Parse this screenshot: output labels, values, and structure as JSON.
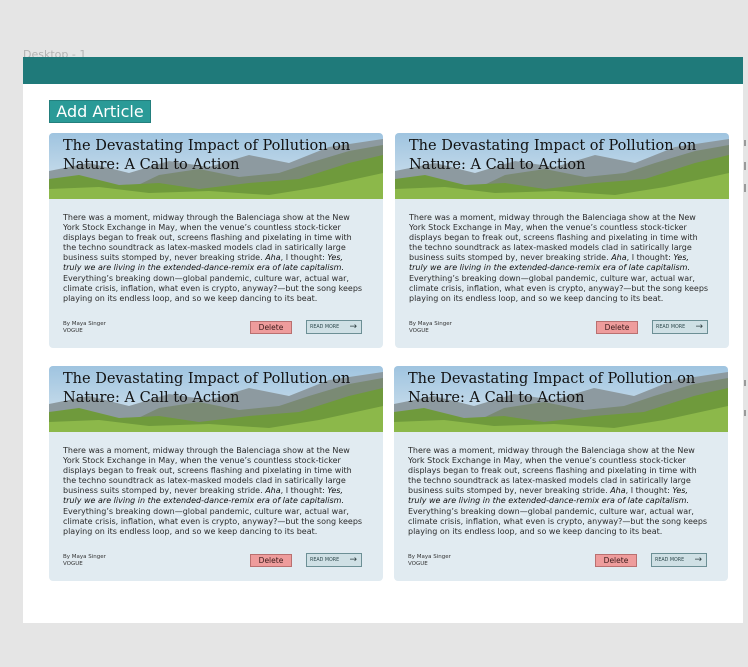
{
  "canvas": {
    "frame_label": "Desktop - 1"
  },
  "toolbar": {
    "add_article_label": "Add Article"
  },
  "colors": {
    "top_bar": "#1f7a7a",
    "add_button": "#2a9a97",
    "card_background": "#e1ebf1",
    "delete_button": "#ee9c9c",
    "read_more_button": "#cfe0e5"
  },
  "articles": [
    {
      "title": "The Devastating Impact of Pollution on Nature: A Call to Action",
      "body_start": "There was a moment, midway through the Balenciaga show at the New York Stock Exchange in May, when the venue’s countless stock-ticker displays began to freak out, screens flashing and pixelating in time with the techno soundtrack as latex-masked models clad in satirically large business suits stomped by, never breaking stride. ",
      "body_aha": "Aha",
      "body_thought": ", I thought: ",
      "body_quote": "Yes, truly we are living in the extended-dance-remix era of late capitalism.",
      "body_end": " Everything’s breaking down—global pandemic, culture war, actual war, climate crisis, inflation, what even is crypto, anyway?—but the song keeps playing on its endless loop, and so we keep dancing to its beat.",
      "author": "By Maya Singer",
      "publication": "VOGUE",
      "delete_label": "Delete",
      "read_more_label": "READ MORE",
      "read_more_icon": "arrow-right-icon"
    },
    {
      "title": "The Devastating Impact of Pollution on Nature: A Call to Action",
      "body_start": "There was a moment, midway through the Balenciaga show at the New York Stock Exchange in May, when the venue’s countless stock-ticker displays began to freak out, screens flashing and pixelating in time with the techno soundtrack as latex-masked models clad in satirically large business suits stomped by, never breaking stride. ",
      "body_aha": "Aha",
      "body_thought": ", I thought: ",
      "body_quote": "Yes, truly we are living in the extended-dance-remix era of late capitalism.",
      "body_end": " Everything’s breaking down—global pandemic, culture war, actual war, climate crisis, inflation, what even is crypto, anyway?—but the song keeps playing on its endless loop, and so we keep dancing to its beat.",
      "author": "By Maya Singer",
      "publication": "VOGUE",
      "delete_label": "Delete",
      "read_more_label": "READ MORE",
      "read_more_icon": "arrow-right-icon"
    },
    {
      "title": "The Devastating Impact of Pollution on Nature: A Call to Action",
      "body_start": "There was a moment, midway through the Balenciaga show at the New York Stock Exchange in May, when the venue’s countless stock-ticker displays began to freak out, screens flashing and pixelating in time with the techno soundtrack as latex-masked models clad in satirically large business suits stomped by, never breaking stride. ",
      "body_aha": "Aha",
      "body_thought": ", I thought: ",
      "body_quote": "Yes, truly we are living in the extended-dance-remix era of late capitalism.",
      "body_end": " Everything’s breaking down—global pandemic, culture war, actual war, climate crisis, inflation, what even is crypto, anyway?—but the song keeps playing on its endless loop, and so we keep dancing to its beat.",
      "author": "By Maya Singer",
      "publication": "VOGUE",
      "delete_label": "Delete",
      "read_more_label": "READ MORE",
      "read_more_icon": "arrow-right-icon"
    },
    {
      "title": "The Devastating Impact of Pollution on Nature: A Call to Action",
      "body_start": "There was a moment, midway through the Balenciaga show at the New York Stock Exchange in May, when the venue’s countless stock-ticker displays began to freak out, screens flashing and pixelating in time with the techno soundtrack as latex-masked models clad in satirically large business suits stomped by, never breaking stride. ",
      "body_aha": "Aha",
      "body_thought": ", I thought: ",
      "body_quote": "Yes, truly we are living in the extended-dance-remix era of late capitalism.",
      "body_end": " Everything’s breaking down—global pandemic, culture war, actual war, climate crisis, inflation, what even is crypto, anyway?—but the song keeps playing on its endless loop, and so we keep dancing to its beat.",
      "author": "By Maya Singer",
      "publication": "VOGUE",
      "delete_label": "Delete",
      "read_more_label": "READ MORE",
      "read_more_icon": "arrow-right-icon"
    }
  ]
}
